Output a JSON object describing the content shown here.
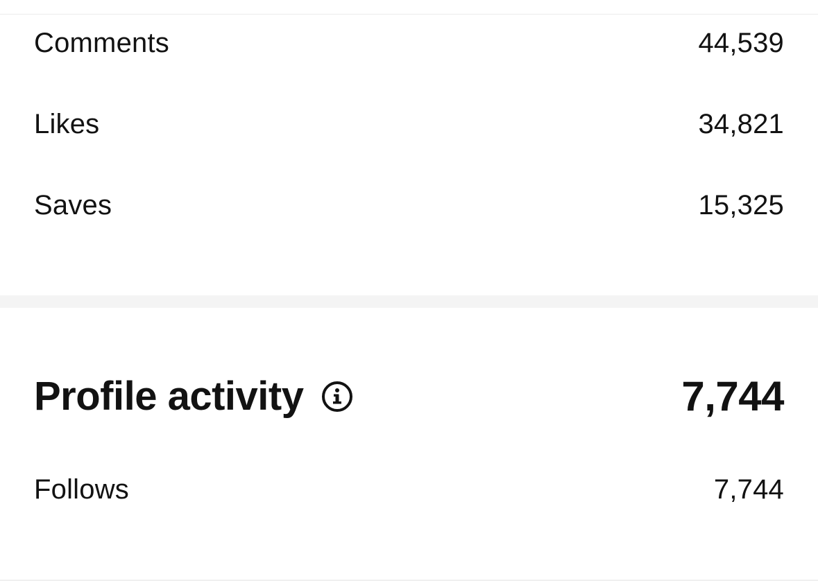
{
  "engagement": {
    "rows": [
      {
        "label": "Comments",
        "value": "44,539"
      },
      {
        "label": "Likes",
        "value": "34,821"
      },
      {
        "label": "Saves",
        "value": "15,325"
      }
    ]
  },
  "profile_activity": {
    "title": "Profile activity",
    "info_icon": "info-icon",
    "total": "7,744",
    "rows": [
      {
        "label": "Follows",
        "value": "7,744"
      }
    ]
  }
}
